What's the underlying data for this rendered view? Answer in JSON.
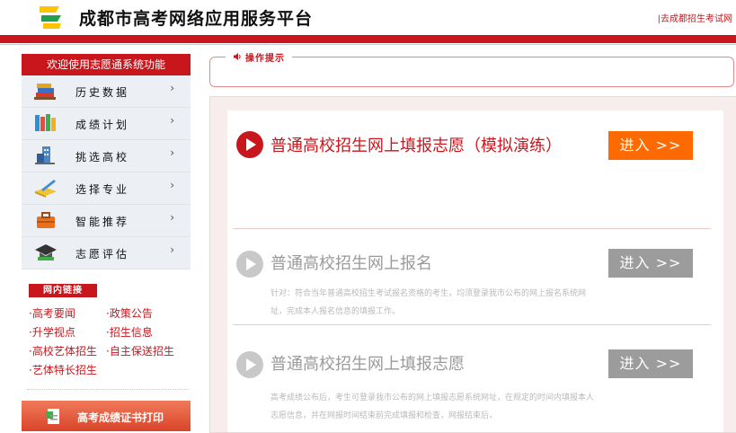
{
  "header": {
    "site_title": "成都市高考网络应用服务平台",
    "top_link": "|去成都招生考试网"
  },
  "sidebar": {
    "title": "欢迎使用志愿通系统功能",
    "items": [
      {
        "label": "历史数据",
        "icon": "books-icon"
      },
      {
        "label": "成绩计划",
        "icon": "bookshelf-icon"
      },
      {
        "label": "挑选高校",
        "icon": "school-building-icon"
      },
      {
        "label": "选择专业",
        "icon": "pen-book-icon"
      },
      {
        "label": "智能推荐",
        "icon": "briefcase-icon"
      },
      {
        "label": "志愿评估",
        "icon": "graduation-cap-icon"
      }
    ],
    "arrow": "›",
    "links_title": "网内链接",
    "links": [
      "·高考要闻",
      "·政策公告",
      "·升学视点",
      "·招生信息",
      "·高校艺体招生",
      "·自主保送招生",
      "·艺体特长招生"
    ],
    "print_button": "高考成绩证书打印"
  },
  "tip": {
    "label": "操作提示",
    "icon": "speaker-icon"
  },
  "entries": [
    {
      "title": "普通高校招生网上填报志愿（模拟演练）",
      "button": "进入 >>",
      "state": "active",
      "description": ""
    },
    {
      "title": "普通高校招生网上报名",
      "button": "进入 >>",
      "state": "dim",
      "description": "针对：符合当年普通高校招生考试报名资格的考生，均须登录我市公布的网上报名系统网址，完成本人报名信息的填报工作。"
    },
    {
      "title": "普通高校招生网上填报志愿",
      "button": "进入 >>",
      "state": "dim",
      "description": "高考成绩公布后，考生可登录我市公布的网上填报志愿系统网址，在规定的时间内填报本人志愿信息，并在网报时间结束前完成填报和检查，网报结束后，"
    }
  ],
  "colors": {
    "brand_red": "#c9161d",
    "active_button": "#ff6a00",
    "dim_button": "#9c9c9c"
  }
}
